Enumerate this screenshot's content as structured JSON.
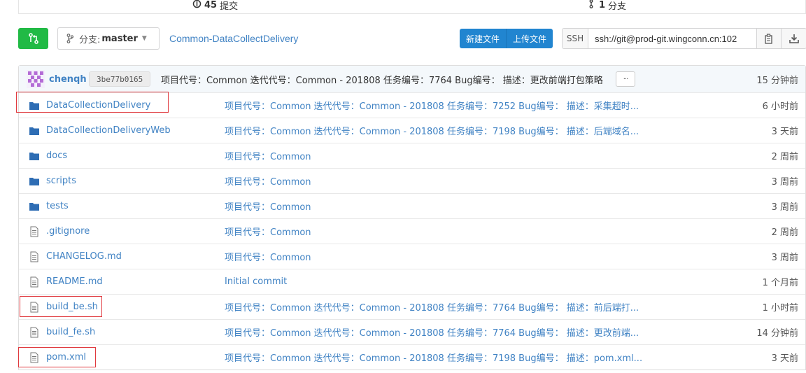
{
  "stats": {
    "commits_count": "45",
    "commits_label": "提交",
    "branches_count": "1",
    "branches_label": "分支"
  },
  "toolbar": {
    "branch_prefix": "分支:",
    "branch_name": "master",
    "breadcrumb": "Common-DataCollectDelivery",
    "new_file": "新建文件",
    "upload_file": "上传文件",
    "protocol": "SSH",
    "clone_url": "ssh://git@prod-git.wingconn.cn:102"
  },
  "latest_commit": {
    "author": "chenqh",
    "sha": "3be77b0165",
    "message": "项目代号：Common 迭代代号：Common - 201808 任务编号：7764 Bug编号： 描述：更改前端打包策略",
    "more": "···",
    "age": "15 分钟前"
  },
  "files": [
    {
      "type": "folder",
      "name": "DataCollectionDelivery",
      "message": "项目代号：Common 迭代代号：Common - 201808 任务编号：7252 Bug编号： 描述：采集超时...",
      "age": "6 小时前"
    },
    {
      "type": "folder",
      "name": "DataCollectionDeliveryWeb",
      "message": "项目代号：Common 迭代代号：Common - 201808 任务编号：7198 Bug编号： 描述：后端域名...",
      "age": "3 天前"
    },
    {
      "type": "folder",
      "name": "docs",
      "message": "项目代号：Common",
      "age": "2 周前"
    },
    {
      "type": "folder",
      "name": "scripts",
      "message": "项目代号：Common",
      "age": "3 周前"
    },
    {
      "type": "folder",
      "name": "tests",
      "message": "项目代号：Common",
      "age": "3 周前"
    },
    {
      "type": "file",
      "name": ".gitignore",
      "message": "项目代号：Common",
      "age": "2 周前"
    },
    {
      "type": "file",
      "name": "CHANGELOG.md",
      "message": "项目代号：Common",
      "age": "3 周前"
    },
    {
      "type": "file",
      "name": "README.md",
      "message": "Initial commit",
      "age": "1 个月前"
    },
    {
      "type": "file",
      "name": "build_be.sh",
      "message": "项目代号：Common 迭代代号：Common - 201808 任务编号：7764 Bug编号： 描述：前后端打...",
      "age": "1 小时前"
    },
    {
      "type": "file",
      "name": "build_fe.sh",
      "message": "项目代号：Common 迭代代号：Common - 201808 任务编号：7764 Bug编号： 描述：更改前端...",
      "age": "14 分钟前"
    },
    {
      "type": "file",
      "name": "pom.xml",
      "message": "项目代号：Common 迭代代号：Common - 201808 任务编号：7198 Bug编号： 描述：pom.xml...",
      "age": "3 天前"
    }
  ],
  "colors": {
    "link": "#4183c4",
    "primary_button": "#2185d0",
    "merge_button": "#21ba45",
    "highlight_box": "#e0393e",
    "folder_icon": "#2e6db4"
  }
}
